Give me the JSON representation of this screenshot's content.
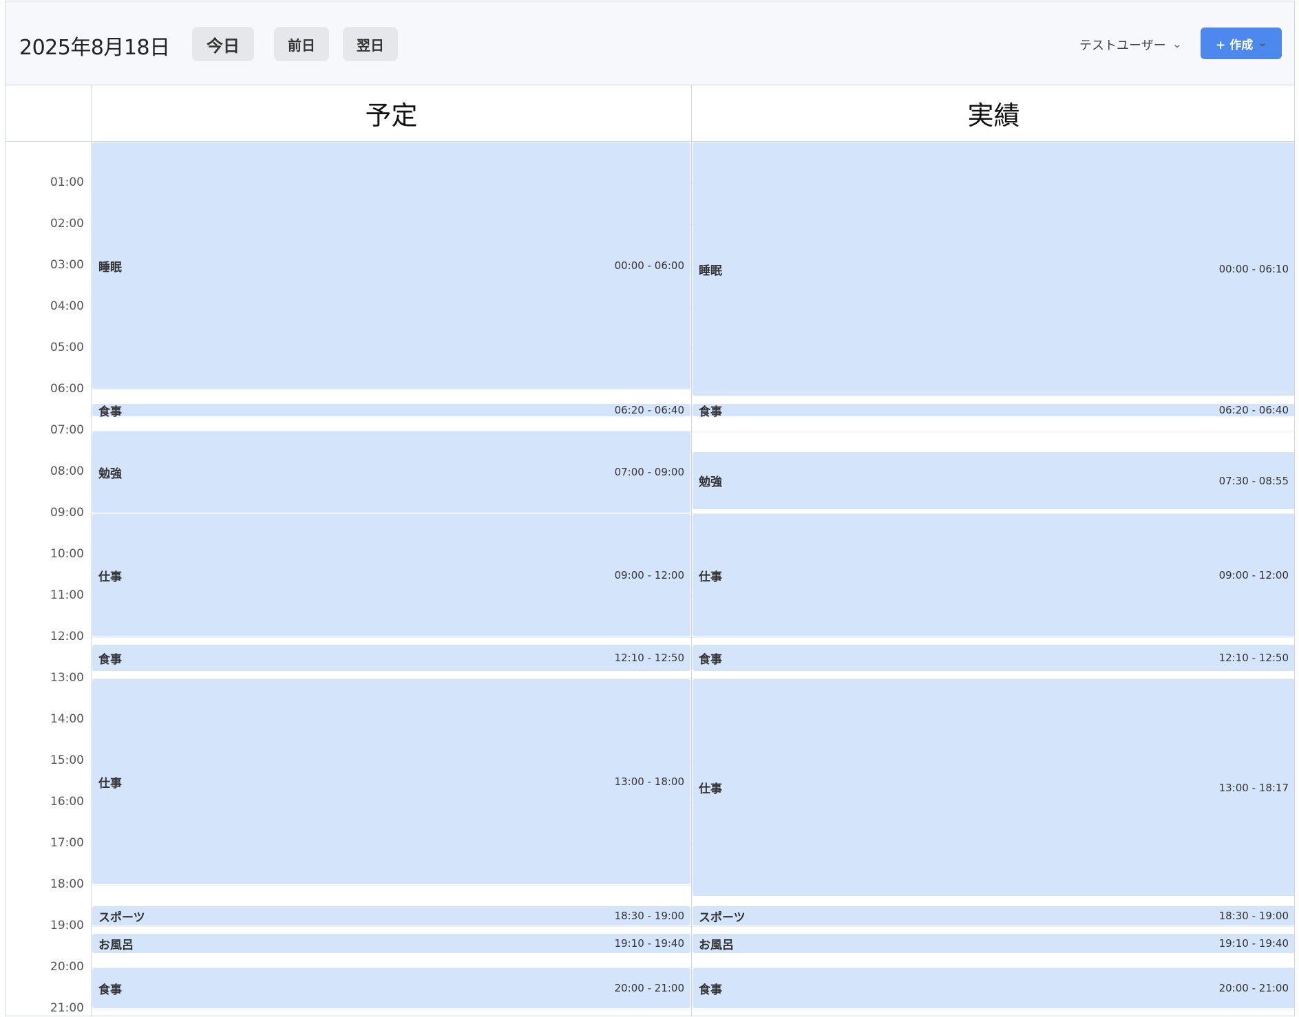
{
  "header": {
    "date": "2025年8月18日",
    "today": "今日",
    "prev": "前日",
    "next": "翌日",
    "user": "テストユーザー",
    "create": "+ 作成"
  },
  "columns": {
    "plan": "予定",
    "actual": "実績"
  },
  "time_labels": [
    "01:00",
    "02:00",
    "03:00",
    "04:00",
    "05:00",
    "06:00",
    "07:00",
    "08:00",
    "09:00",
    "10:00",
    "11:00",
    "12:00",
    "13:00",
    "14:00",
    "15:00",
    "16:00",
    "17:00",
    "18:00",
    "19:00",
    "20:00",
    "21:00"
  ],
  "plan_events": [
    {
      "title": "睡眠",
      "time": "00:00 - 06:00",
      "start": "00:00",
      "end": "06:00"
    },
    {
      "title": "食事",
      "time": "06:20 - 06:40",
      "start": "06:20",
      "end": "06:40"
    },
    {
      "title": "勉強",
      "time": "07:00 - 09:00",
      "start": "07:00",
      "end": "09:00"
    },
    {
      "title": "仕事",
      "time": "09:00 - 12:00",
      "start": "09:00",
      "end": "12:00"
    },
    {
      "title": "食事",
      "time": "12:10 - 12:50",
      "start": "12:10",
      "end": "12:50"
    },
    {
      "title": "仕事",
      "time": "13:00 - 18:00",
      "start": "13:00",
      "end": "18:00"
    },
    {
      "title": "スポーツ",
      "time": "18:30 - 19:00",
      "start": "18:30",
      "end": "19:00"
    },
    {
      "title": "お風呂",
      "time": "19:10 - 19:40",
      "start": "19:10",
      "end": "19:40"
    },
    {
      "title": "食事",
      "time": "20:00 - 21:00",
      "start": "20:00",
      "end": "21:00"
    }
  ],
  "actual_events": [
    {
      "title": "睡眠",
      "time": "00:00 - 06:10",
      "start": "00:00",
      "end": "06:10"
    },
    {
      "title": "食事",
      "time": "06:20 - 06:40",
      "start": "06:20",
      "end": "06:40"
    },
    {
      "title": "勉強",
      "time": "07:30 - 08:55",
      "start": "07:30",
      "end": "08:55"
    },
    {
      "title": "仕事",
      "time": "09:00 - 12:00",
      "start": "09:00",
      "end": "12:00"
    },
    {
      "title": "食事",
      "time": "12:10 - 12:50",
      "start": "12:10",
      "end": "12:50"
    },
    {
      "title": "仕事",
      "time": "13:00 - 18:17",
      "start": "13:00",
      "end": "18:17"
    },
    {
      "title": "スポーツ",
      "time": "18:30 - 19:00",
      "start": "18:30",
      "end": "19:00"
    },
    {
      "title": "お風呂",
      "time": "19:10 - 19:40",
      "start": "19:10",
      "end": "19:40"
    },
    {
      "title": "食事",
      "time": "20:00 - 21:00",
      "start": "20:00",
      "end": "21:00"
    }
  ],
  "colors": {
    "event_bg": "#d4e4fb",
    "accent": "#4d88ee"
  }
}
